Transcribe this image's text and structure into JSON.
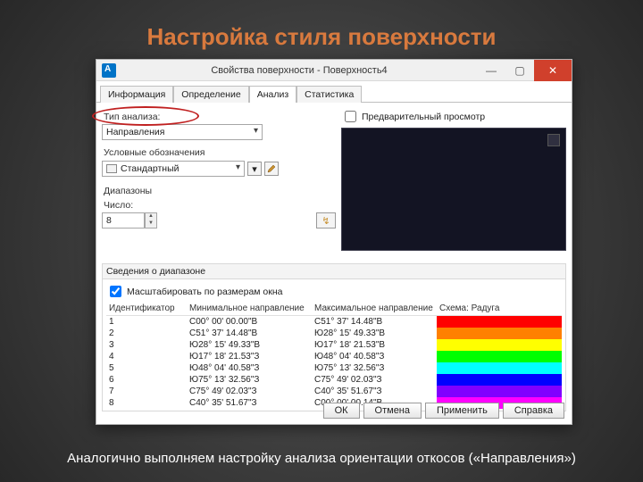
{
  "slide": {
    "title": "Настройка стиля поверхности",
    "caption": "Аналогично выполняем настройку анализа ориентации откосов («Направления»)"
  },
  "dialog": {
    "title": "Свойства поверхности - Поверхность4",
    "tabs": [
      "Информация",
      "Определение",
      "Анализ",
      "Статистика"
    ],
    "active_tab": 2,
    "analysis": {
      "type_label": "Тип анализа:",
      "type_value": "Направления",
      "legend_label": "Условные обозначения",
      "legend_value": "Стандартный",
      "ranges_label": "Диапазоны",
      "count_label": "Число:",
      "count_value": "8",
      "preview_label": "Предварительный просмотр"
    },
    "range_section": {
      "header": "Сведения о диапазоне",
      "scale_label": "Масштабировать по размерам окна",
      "columns": [
        "Идентификатор",
        "Минимальное направление",
        "Максимальное направление",
        "Схема: Радуга"
      ],
      "rows": [
        {
          "id": "1",
          "min": "С00° 00' 00.00\"В",
          "max": "С51° 37' 14.48\"В",
          "color": "#ff0000"
        },
        {
          "id": "2",
          "min": "С51° 37' 14.48\"В",
          "max": "Ю28° 15' 49.33\"В",
          "color": "#ff8000"
        },
        {
          "id": "3",
          "min": "Ю28° 15' 49.33\"В",
          "max": "Ю17° 18' 21.53\"В",
          "color": "#ffff00"
        },
        {
          "id": "4",
          "min": "Ю17° 18' 21.53\"З",
          "max": "Ю48° 04' 40.58\"З",
          "color": "#00ff00"
        },
        {
          "id": "5",
          "min": "Ю48° 04' 40.58\"З",
          "max": "Ю75° 13' 32.56\"З",
          "color": "#00ffff"
        },
        {
          "id": "6",
          "min": "Ю75° 13' 32.56\"З",
          "max": "С75° 49' 02.03\"З",
          "color": "#0000ff"
        },
        {
          "id": "7",
          "min": "С75° 49' 02.03\"З",
          "max": "С40° 35' 51.67\"З",
          "color": "#8000ff"
        },
        {
          "id": "8",
          "min": "С40° 35' 51.67\"З",
          "max": "С00° 00' 00.14\"В",
          "color": "#ff00ff"
        }
      ]
    },
    "buttons": {
      "ok": "ОК",
      "cancel": "Отмена",
      "apply": "Применить",
      "help": "Справка"
    }
  }
}
